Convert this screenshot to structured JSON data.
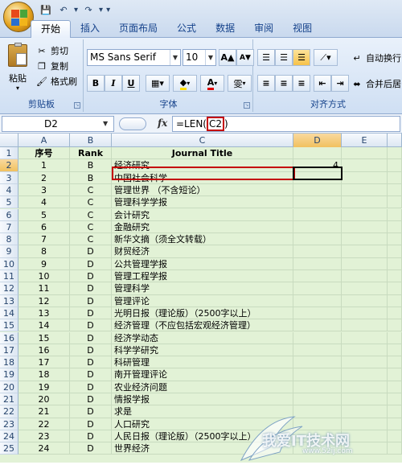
{
  "quick_access": {
    "save": "💾",
    "undo": "↶",
    "redo": "↷",
    "more": "▾"
  },
  "tabs": [
    "开始",
    "插入",
    "页面布局",
    "公式",
    "数据",
    "审阅",
    "视图"
  ],
  "ribbon": {
    "clipboard": {
      "label": "剪贴板",
      "paste": "粘贴",
      "cut": "剪切",
      "copy": "复制",
      "format_painter": "格式刷"
    },
    "font": {
      "label": "字体",
      "font_name": "MS Sans Serif",
      "font_size": "10",
      "bold": "B",
      "italic": "I",
      "underline": "U",
      "grow": "A▲",
      "shrink": "A▼",
      "phonetic": "雯"
    },
    "alignment": {
      "label": "对齐方式",
      "wrap_text": "自动换行",
      "merge_center": "合并后居"
    }
  },
  "formula_bar": {
    "name_box": "D2",
    "fx": "fx",
    "formula_prefix": "=LEN(",
    "formula_ref": "C2",
    "formula_suffix": ")"
  },
  "grid": {
    "columns": [
      "A",
      "B",
      "C",
      "D",
      "E"
    ],
    "rows": [
      {
        "n": "1",
        "a": "序号",
        "b": "Rank",
        "c": "Journal Title",
        "d": ""
      },
      {
        "n": "2",
        "a": "1",
        "b": "B",
        "c": "经济研究",
        "d": "4"
      },
      {
        "n": "3",
        "a": "2",
        "b": "B",
        "c": "中国社会科学",
        "d": ""
      },
      {
        "n": "4",
        "a": "3",
        "b": "C",
        "c": "管理世界 （不含短论）",
        "d": ""
      },
      {
        "n": "5",
        "a": "4",
        "b": "C",
        "c": "管理科学学报",
        "d": ""
      },
      {
        "n": "6",
        "a": "5",
        "b": "C",
        "c": "会计研究",
        "d": ""
      },
      {
        "n": "7",
        "a": "6",
        "b": "C",
        "c": "金融研究",
        "d": ""
      },
      {
        "n": "8",
        "a": "7",
        "b": "C",
        "c": "新华文摘（须全文转载）",
        "d": ""
      },
      {
        "n": "9",
        "a": "8",
        "b": "D",
        "c": "财贸经济",
        "d": ""
      },
      {
        "n": "10",
        "a": "9",
        "b": "D",
        "c": "公共管理学报",
        "d": ""
      },
      {
        "n": "11",
        "a": "10",
        "b": "D",
        "c": "管理工程学报",
        "d": ""
      },
      {
        "n": "12",
        "a": "11",
        "b": "D",
        "c": "管理科学",
        "d": ""
      },
      {
        "n": "13",
        "a": "12",
        "b": "D",
        "c": "管理评论",
        "d": ""
      },
      {
        "n": "14",
        "a": "13",
        "b": "D",
        "c": "光明日报（理论版）（2500字以上）",
        "d": ""
      },
      {
        "n": "15",
        "a": "14",
        "b": "D",
        "c": "经济管理（不应包括宏观经济管理）",
        "d": ""
      },
      {
        "n": "16",
        "a": "15",
        "b": "D",
        "c": "经济学动态",
        "d": ""
      },
      {
        "n": "17",
        "a": "16",
        "b": "D",
        "c": "科学学研究",
        "d": ""
      },
      {
        "n": "18",
        "a": "17",
        "b": "D",
        "c": "科研管理",
        "d": ""
      },
      {
        "n": "19",
        "a": "18",
        "b": "D",
        "c": "南开管理评论",
        "d": ""
      },
      {
        "n": "20",
        "a": "19",
        "b": "D",
        "c": "农业经济问题",
        "d": ""
      },
      {
        "n": "21",
        "a": "20",
        "b": "D",
        "c": "情报学报",
        "d": ""
      },
      {
        "n": "22",
        "a": "21",
        "b": "D",
        "c": "求是",
        "d": ""
      },
      {
        "n": "23",
        "a": "22",
        "b": "D",
        "c": "人口研究",
        "d": ""
      },
      {
        "n": "24",
        "a": "23",
        "b": "D",
        "c": "人民日报（理论版）（2500字以上）",
        "d": ""
      },
      {
        "n": "25",
        "a": "24",
        "b": "D",
        "c": "世界经济",
        "d": ""
      }
    ]
  },
  "watermark": {
    "text": "我爱IT技术网",
    "url": "www.52ij.com"
  }
}
